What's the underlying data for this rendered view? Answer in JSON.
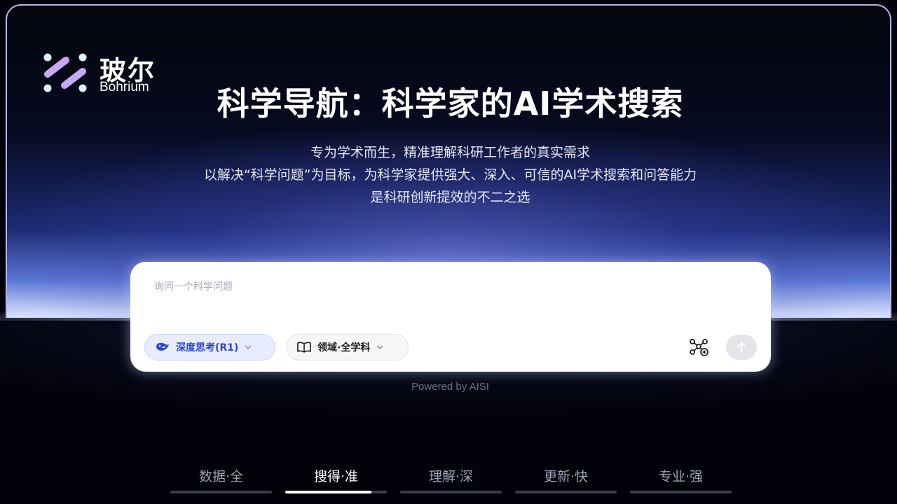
{
  "logo": {
    "name_cn": "玻尔",
    "name_en": "Bohrium"
  },
  "hero": {
    "title": "科学导航：科学家的AI学术搜索",
    "subtitle_lines": [
      "专为学术而生，精准理解科研工作者的真实需求",
      "以解决“科学问题”为目标，为科学家提供强大、深入、可信的AI学术搜索和问答能力",
      "是科研创新提效的不二之选"
    ]
  },
  "search": {
    "placeholder": "询问一个科学问题",
    "value": "",
    "deep_think_label": "深度思考(R1)",
    "field_label": "领域·全学科",
    "graph_icon": "graph-add-icon",
    "send_icon": "arrow-up-icon"
  },
  "powered_by": "Powered by AISI",
  "tabs": [
    {
      "label": "数据·全",
      "progress": 0
    },
    {
      "label": "搜得·准",
      "progress": 0.85
    },
    {
      "label": "理解·深",
      "progress": 0
    },
    {
      "label": "更新·快",
      "progress": 0
    },
    {
      "label": "专业·强",
      "progress": 0
    }
  ],
  "active_tab": 1,
  "colors": {
    "accent": "#2b46d4",
    "frame": "#b9b6e8"
  }
}
